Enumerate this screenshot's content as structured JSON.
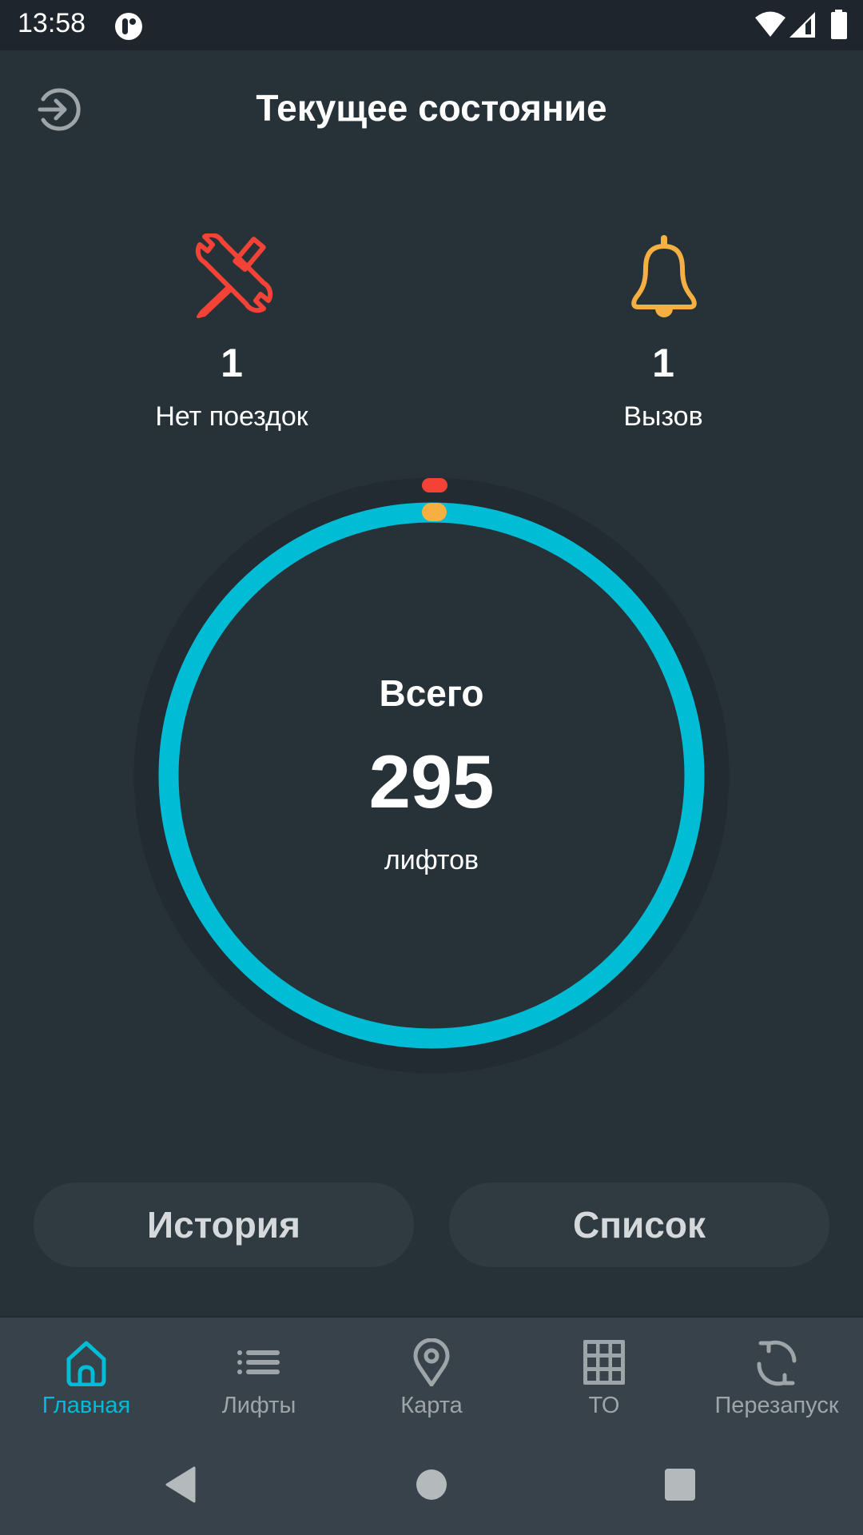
{
  "status_bar": {
    "time": "13:58",
    "icons": [
      "app-notification-icon",
      "wifi-icon",
      "cell-signal-icon",
      "battery-icon"
    ]
  },
  "header": {
    "title": "Текущее состояние",
    "left_icon": "login-icon"
  },
  "stats": [
    {
      "icon": "tools-icon",
      "count": "1",
      "label": "Нет поездок",
      "color": "#F44336"
    },
    {
      "icon": "bell-icon",
      "count": "1",
      "label": "Вызов",
      "color": "#F5B041"
    }
  ],
  "summary": {
    "title": "Всего",
    "total": "295",
    "unit": "лифтов",
    "ring_color": "#00BCD4",
    "markers": [
      {
        "name": "no-trips",
        "count": 1,
        "color": "#F44336"
      },
      {
        "name": "call",
        "count": 1,
        "color": "#F5B041"
      }
    ]
  },
  "buttons": {
    "history": "История",
    "list": "Список"
  },
  "bottom_nav": {
    "active_color": "#00BCD4",
    "items": [
      {
        "label": "Главная",
        "icon": "home-icon",
        "active": true
      },
      {
        "label": "Лифты",
        "icon": "list-icon",
        "active": false
      },
      {
        "label": "Карта",
        "icon": "map-pin-icon",
        "active": false
      },
      {
        "label": "ТО",
        "icon": "grid-icon",
        "active": false
      },
      {
        "label": "Перезапуск",
        "icon": "refresh-icon",
        "active": false
      }
    ]
  },
  "system_nav": [
    "back-icon",
    "home-circle-icon",
    "recents-icon"
  ]
}
